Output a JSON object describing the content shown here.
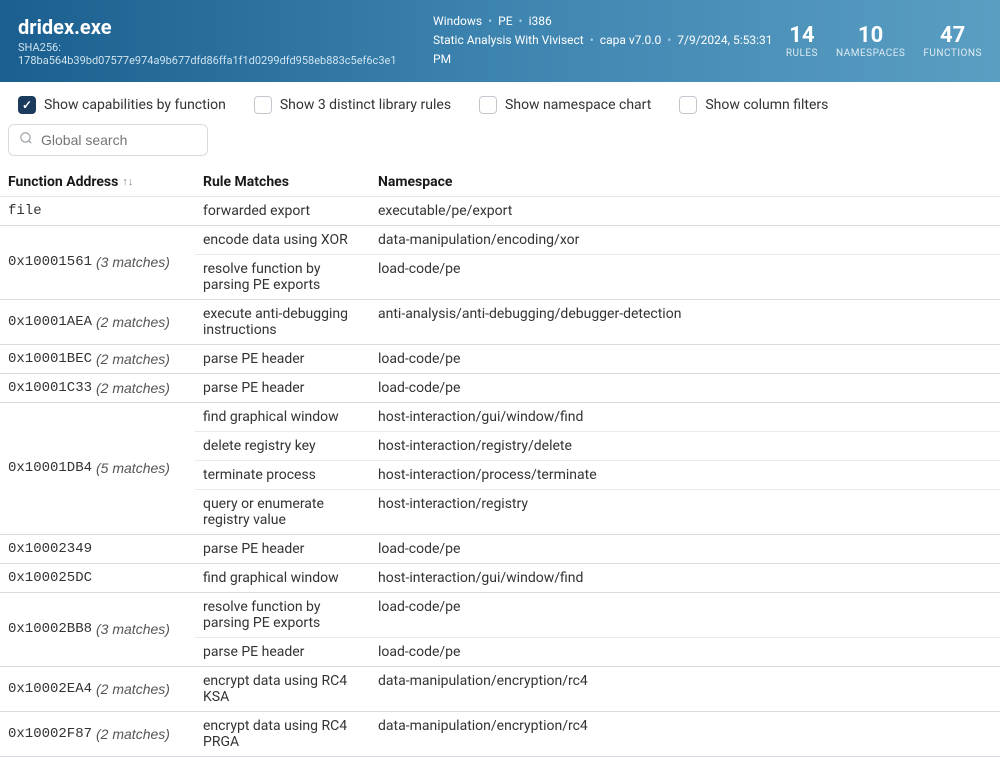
{
  "header": {
    "filename": "dridex.exe",
    "sha_label": "SHA256:",
    "sha256": "178ba564b39bd07577e974a9b677dfd86ffa1f1d0299dfd958eb883c5ef6c3e1",
    "meta1": [
      "Windows",
      "PE",
      "i386"
    ],
    "meta2": [
      "Static Analysis With Vivisect",
      "capa v7.0.0",
      "7/9/2024, 5:53:31 PM"
    ],
    "stats": [
      {
        "num": "14",
        "label": "RULES"
      },
      {
        "num": "10",
        "label": "NAMESPACES"
      },
      {
        "num": "47",
        "label": "FUNCTIONS"
      }
    ]
  },
  "controls": {
    "cb1": "Show capabilities by function",
    "cb2": "Show 3 distinct library rules",
    "cb3": "Show namespace chart",
    "cb4": "Show column filters"
  },
  "search": {
    "placeholder": "Global search"
  },
  "columns": {
    "addr": "Function Address",
    "rule": "Rule Matches",
    "ns": "Namespace"
  },
  "rows": [
    {
      "addr": "file",
      "count": "",
      "matches": [
        {
          "rule": "forwarded export",
          "ns": "executable/pe/export"
        }
      ]
    },
    {
      "addr": "0x10001561",
      "count": "(3 matches)",
      "matches": [
        {
          "rule": "encode data using XOR",
          "ns": "data-manipulation/encoding/xor"
        },
        {
          "rule": "resolve function by parsing PE exports",
          "ns": "load-code/pe"
        }
      ]
    },
    {
      "addr": "0x10001AEA",
      "count": "(2 matches)",
      "matches": [
        {
          "rule": "execute anti-debugging instructions",
          "ns": "anti-analysis/anti-debugging/debugger-detection"
        }
      ]
    },
    {
      "addr": "0x10001BEC",
      "count": "(2 matches)",
      "matches": [
        {
          "rule": "parse PE header",
          "ns": "load-code/pe"
        }
      ]
    },
    {
      "addr": "0x10001C33",
      "count": "(2 matches)",
      "matches": [
        {
          "rule": "parse PE header",
          "ns": "load-code/pe"
        }
      ]
    },
    {
      "addr": "0x10001DB4",
      "count": "(5 matches)",
      "matches": [
        {
          "rule": "find graphical window",
          "ns": "host-interaction/gui/window/find"
        },
        {
          "rule": "delete registry key",
          "ns": "host-interaction/registry/delete"
        },
        {
          "rule": "terminate process",
          "ns": "host-interaction/process/terminate"
        },
        {
          "rule": "query or enumerate registry value",
          "ns": "host-interaction/registry"
        }
      ]
    },
    {
      "addr": "0x10002349",
      "count": "",
      "matches": [
        {
          "rule": "parse PE header",
          "ns": "load-code/pe"
        }
      ]
    },
    {
      "addr": "0x100025DC",
      "count": "",
      "matches": [
        {
          "rule": "find graphical window",
          "ns": "host-interaction/gui/window/find"
        }
      ]
    },
    {
      "addr": "0x10002BB8",
      "count": "(3 matches)",
      "matches": [
        {
          "rule": "resolve function by parsing PE exports",
          "ns": "load-code/pe"
        },
        {
          "rule": "parse PE header",
          "ns": "load-code/pe"
        }
      ]
    },
    {
      "addr": "0x10002EA4",
      "count": "(2 matches)",
      "matches": [
        {
          "rule": "encrypt data using RC4 KSA",
          "ns": "data-manipulation/encryption/rc4"
        }
      ]
    },
    {
      "addr": "0x10002F87",
      "count": "(2 matches)",
      "matches": [
        {
          "rule": "encrypt data using RC4 PRGA",
          "ns": "data-manipulation/encryption/rc4"
        }
      ]
    }
  ]
}
